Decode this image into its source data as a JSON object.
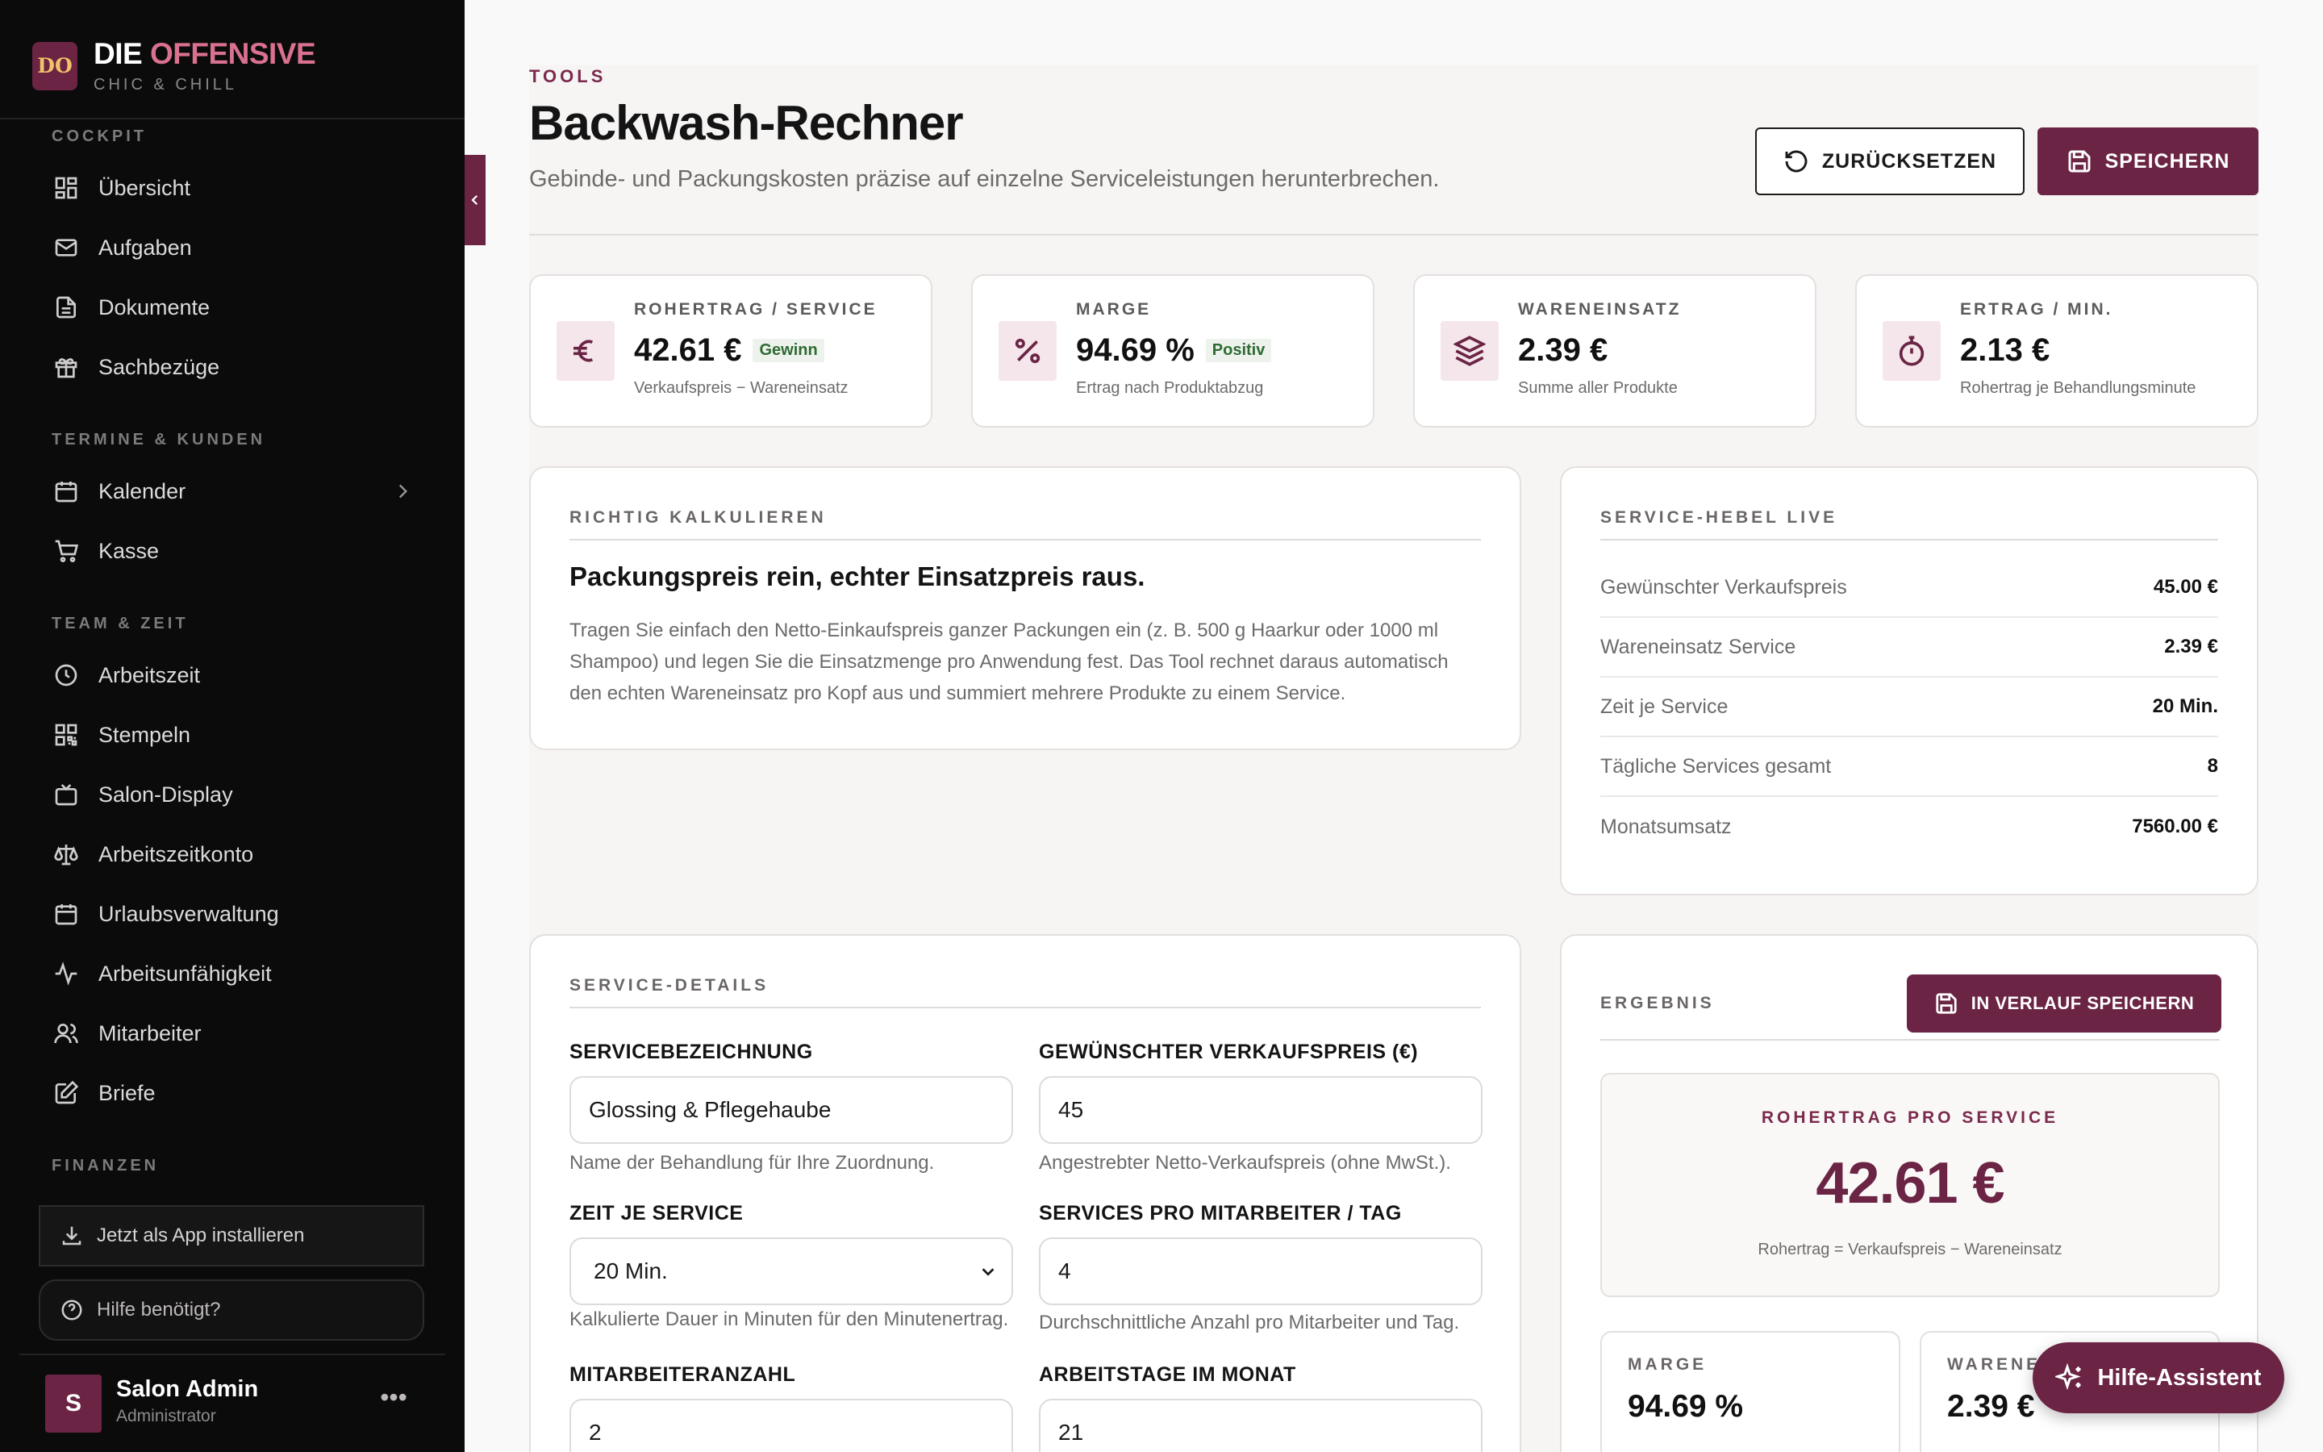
{
  "brand": {
    "logo": "DO",
    "title_a": "DIE",
    "title_b": "OFFENSIVE",
    "subtitle": "CHIC & CHILL"
  },
  "sidebar": {
    "sections": [
      {
        "label": "COCKPIT",
        "items": [
          {
            "label": "Übersicht",
            "icon": "dashboard-icon"
          },
          {
            "label": "Aufgaben",
            "icon": "mail-icon"
          },
          {
            "label": "Dokumente",
            "icon": "document-icon"
          },
          {
            "label": "Sachbezüge",
            "icon": "gift-icon"
          }
        ]
      },
      {
        "label": "TERMINE & KUNDEN",
        "items": [
          {
            "label": "Kalender",
            "icon": "calendar-icon"
          },
          {
            "label": "Kasse",
            "icon": "cart-icon"
          }
        ]
      },
      {
        "label": "TEAM & ZEIT",
        "items": [
          {
            "label": "Arbeitszeit",
            "icon": "clock-icon"
          },
          {
            "label": "Stempeln",
            "icon": "qr-icon"
          },
          {
            "label": "Salon-Display",
            "icon": "tv-icon"
          },
          {
            "label": "Arbeitszeitkonto",
            "icon": "scale-icon"
          },
          {
            "label": "Urlaubsverwaltung",
            "icon": "calendar-icon"
          },
          {
            "label": "Arbeitsunfähigkeit",
            "icon": "pulse-icon"
          },
          {
            "label": "Mitarbeiter",
            "icon": "users-icon"
          },
          {
            "label": "Briefe",
            "icon": "edit-icon"
          }
        ]
      },
      {
        "label": "FINANZEN",
        "items": []
      }
    ],
    "install_label": "Jetzt als App installieren",
    "help_label": "Hilfe benötigt?",
    "user": {
      "initial": "S",
      "name": "Salon Admin",
      "role": "Administrator",
      "more": "•••"
    }
  },
  "header": {
    "eyebrow": "TOOLS",
    "title": "Backwash-Rechner",
    "subtitle": "Gebinde- und Packungskosten präzise auf einzelne Serviceleistungen herunterbrechen.",
    "reset_label": "ZURÜCKSETZEN",
    "save_label": "SPEICHERN"
  },
  "kpis": [
    {
      "label": "ROHERTRAG / SERVICE",
      "value": "42.61 €",
      "badge": "Gewinn",
      "note": "Verkaufspreis − Wareneinsatz",
      "icon": "euro-icon"
    },
    {
      "label": "MARGE",
      "value": "94.69 %",
      "badge": "Positiv",
      "note": "Ertrag nach Produktabzug",
      "icon": "percent-icon"
    },
    {
      "label": "WARENEINSATZ",
      "value": "2.39 €",
      "badge": "",
      "note": "Summe aller Produkte",
      "icon": "layers-icon"
    },
    {
      "label": "ERTRAG / MIN.",
      "value": "2.13 €",
      "badge": "",
      "note": "Rohertrag je Behandlungsminute",
      "icon": "timer-icon"
    }
  ],
  "intro": {
    "label": "RICHTIG KALKULIEREN",
    "heading": "Packungspreis rein, echter Einsatzpreis raus.",
    "body": "Tragen Sie einfach den Netto-Einkaufspreis ganzer Packungen ein (z. B. 500 g Haarkur oder 1000 ml Shampoo) und legen Sie die Einsatzmenge pro Anwendung fest. Das Tool rechnet daraus automatisch den echten Wareneinsatz pro Kopf aus und summiert mehrere Produkte zu einem Service."
  },
  "levers": {
    "label": "SERVICE-HEBEL LIVE",
    "rows": [
      {
        "label": "Gewünschter Verkaufspreis",
        "value": "45.00 €"
      },
      {
        "label": "Wareneinsatz Service",
        "value": "2.39 €"
      },
      {
        "label": "Zeit je Service",
        "value": "20 Min."
      },
      {
        "label": "Tägliche Services gesamt",
        "value": "8"
      },
      {
        "label": "Monatsumsatz",
        "value": "7560.00 €"
      }
    ]
  },
  "details": {
    "label": "SERVICE-DETAILS",
    "fields": [
      {
        "label": "SERVICEBEZEICHNUNG",
        "value": "Glossing & Pflegehaube",
        "hint": "Name der Behandlung für Ihre Zuordnung."
      },
      {
        "label": "GEWÜNSCHTER VERKAUFSPREIS (€)",
        "value": "45",
        "hint": "Angestrebter Netto-Verkaufspreis (ohne MwSt.)."
      },
      {
        "label": "ZEIT JE SERVICE",
        "value": "20 Min.",
        "hint": "Kalkulierte Dauer in Minuten für den Minutenertrag."
      },
      {
        "label": "SERVICES PRO MITARBEITER / TAG",
        "value": "4",
        "hint": "Durchschnittliche Anzahl pro Mitarbeiter und Tag."
      },
      {
        "label": "MITARBEITERANZAHL",
        "value": "2",
        "hint": ""
      },
      {
        "label": "ARBEITSTAGE IM MONAT",
        "value": "21",
        "hint": ""
      }
    ]
  },
  "result": {
    "label": "ERGEBNIS",
    "history_label": "IN VERLAUF SPEICHERN",
    "main_label": "ROHERTRAG PRO SERVICE",
    "main_value": "42.61 €",
    "main_note": "Rohertrag = Verkaufspreis − Wareneinsatz",
    "mini": [
      {
        "label": "MARGE",
        "value": "94.69 %"
      },
      {
        "label": "WARENEINSATZ",
        "value": "2.39 €"
      }
    ]
  },
  "assistant_label": "Hilfe-Assistent"
}
